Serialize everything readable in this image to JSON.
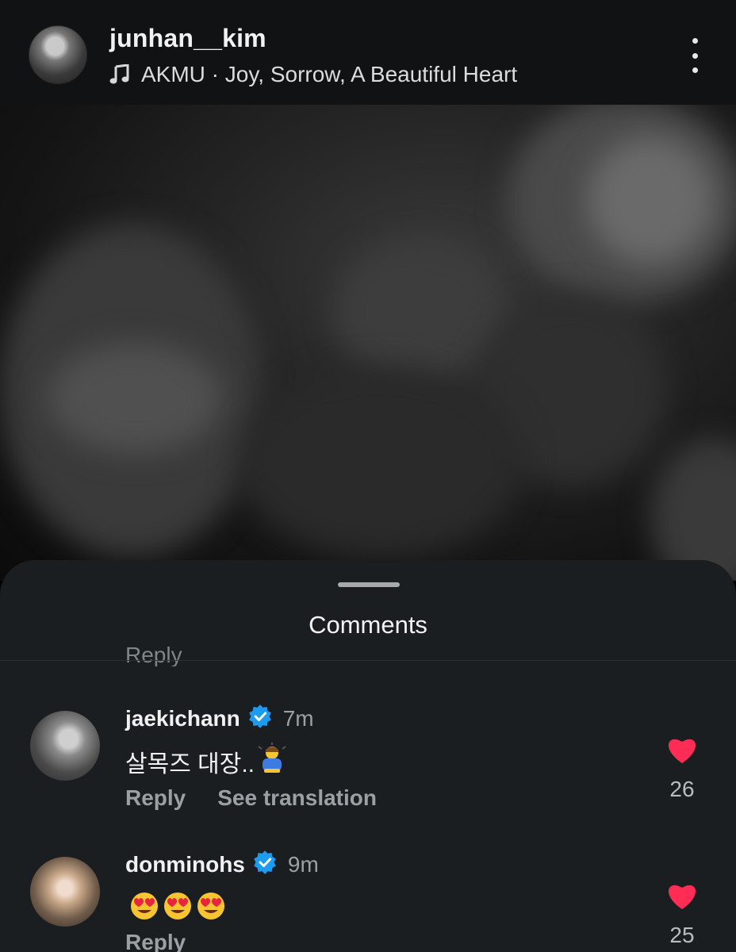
{
  "header": {
    "username": "junhan__kim",
    "music": "AKMU · Joy, Sorrow, A Beautiful Heart"
  },
  "sheet": {
    "title": "Comments",
    "truncated_reply_label": "Reply"
  },
  "comments": [
    {
      "username": "jaekichann",
      "verified": true,
      "time": "7m",
      "text": "살목즈 대장..",
      "emoji": "person-bowing",
      "actions": [
        "Reply",
        "See translation"
      ],
      "likes": "26"
    },
    {
      "username": "donminohs",
      "verified": true,
      "time": "9m",
      "text": "",
      "emoji": "smiling-face-with-heart-eyes x3",
      "actions": [
        "Reply"
      ],
      "likes": "25"
    }
  ],
  "colors": {
    "verified": "#1d9bf0",
    "like": "#ff2d55",
    "sheet_bg": "#1b1e21"
  }
}
